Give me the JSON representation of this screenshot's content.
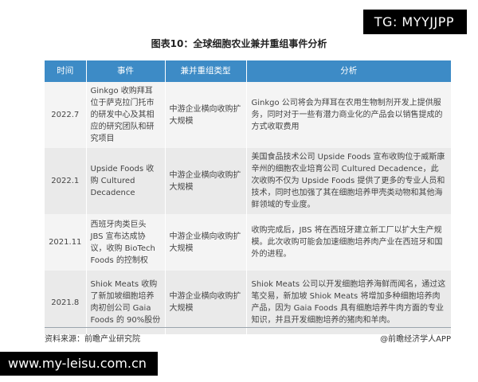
{
  "tag": "TG: MYYJJPP",
  "title": "图表10：全球细胞农业兼并重组事件分析",
  "table": {
    "headers": [
      "时间",
      "事件",
      "兼并重组类型",
      "分析"
    ],
    "rows": [
      {
        "time": "2022.7",
        "event": "Ginkgo 收购拜耳位于萨克拉门托市的研发中心及其相应的研究团队和研究项目",
        "type": "中游企业横向收购扩大规模",
        "analysis": "Ginkgo 公司将会为拜耳在农用生物制剂开发上提供服务，同时对于一些有潜力商业化的产品会以销售提成的方式收取费用"
      },
      {
        "time": "2022.1",
        "event": "Upside Foods 收购 Cultured Decadence",
        "type": "中游企业横向收购扩大规模",
        "analysis": "美国食品技术公司 Upside Foods 宣布收购位于威斯康辛州的细胞农业培育公司 Cultured Decadence，此次收购不仅为 Upside Foods 提供了更多的专业人员和技术，同时也加强了其在细胞培养甲壳类动物和其他海鲜领域的专业度。"
      },
      {
        "time": "2021.11",
        "event": "西班牙肉类巨头 JBS 宣布达成协议，收购 BioTech Foods 的控制权",
        "type": "中游企业横向收购扩大规模",
        "analysis": "收购完成后，JBS 将在西班牙建立新工厂以扩大生产规模。此次收购可能会加速细胞培养肉产业在西班牙和国外的进程。"
      },
      {
        "time": "2021.8",
        "event": "Shiok Meats 收购了新加坡细胞培养肉初创公司 Gaia Foods 的 90%股份",
        "type": "中游企业横向收购扩大规模",
        "analysis": "Shiok Meats 公司以开发细胞培养海鲜而闻名，通过这笔交易，新加坡 Shiok Meats 将增加多种细胞培养肉产品，因为 Gaia Foods 具有细胞培养牛肉方面的专业知识，并且开发细胞培养的猪肉和羊肉。"
      }
    ]
  },
  "footer": {
    "source": "资料来源：前瞻产业研究院",
    "credit": "@前瞻经济学人APP"
  },
  "site": "www.my-leisu.com.cn"
}
